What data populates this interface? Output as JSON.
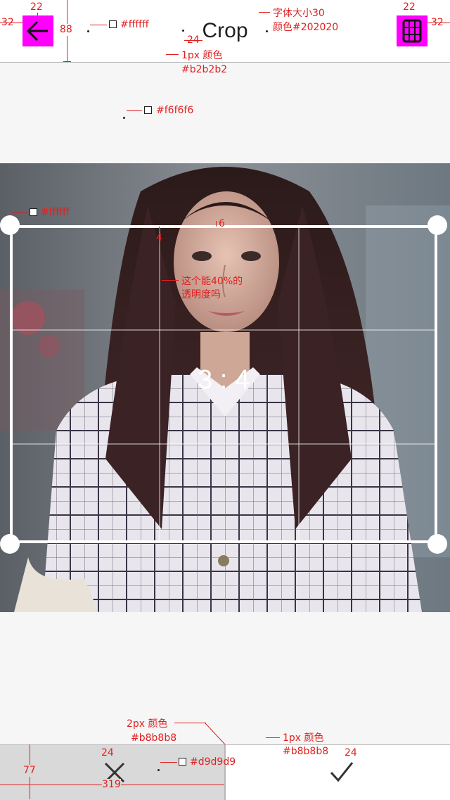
{
  "header": {
    "title": "Crop",
    "back_icon": "arrow-left-icon",
    "grid_icon": "grid-icon"
  },
  "crop": {
    "ratio_label": "3 : 4"
  },
  "bottom": {
    "cancel_icon": "close-icon",
    "confirm_icon": "checkmark-icon"
  },
  "annotations": {
    "margin_left": "32",
    "margin_right": "32",
    "icon_size_left": "22",
    "icon_size_right": "22",
    "header_height": "88",
    "header_color": "#ffffff",
    "title_spacing": "24",
    "title_font": "字体大小30",
    "title_color": "颜色#202020",
    "divider_label": "1px 颜色",
    "divider_color": "#b2b2b2",
    "bg_color": "#f6f6f6",
    "crop_color": "#ffffff",
    "grid_offset": "4",
    "border_width": "6",
    "opacity_question_1": "这个能40%的",
    "opacity_question_2": "透明度吗",
    "bottom_divider_label": "2px 颜色",
    "bottom_divider_color": "#b8b8b8",
    "top_border_label": "1px 颜色",
    "top_border_color": "#b8b8b8",
    "cancel_icon_size": "24",
    "confirm_icon_size": "24",
    "cancel_bg_color": "#d9d9d9",
    "bar_height": "77",
    "cancel_width": "319"
  },
  "colors": {
    "accent_placeholder": "#ff00ff",
    "annotation": "#e02020"
  }
}
